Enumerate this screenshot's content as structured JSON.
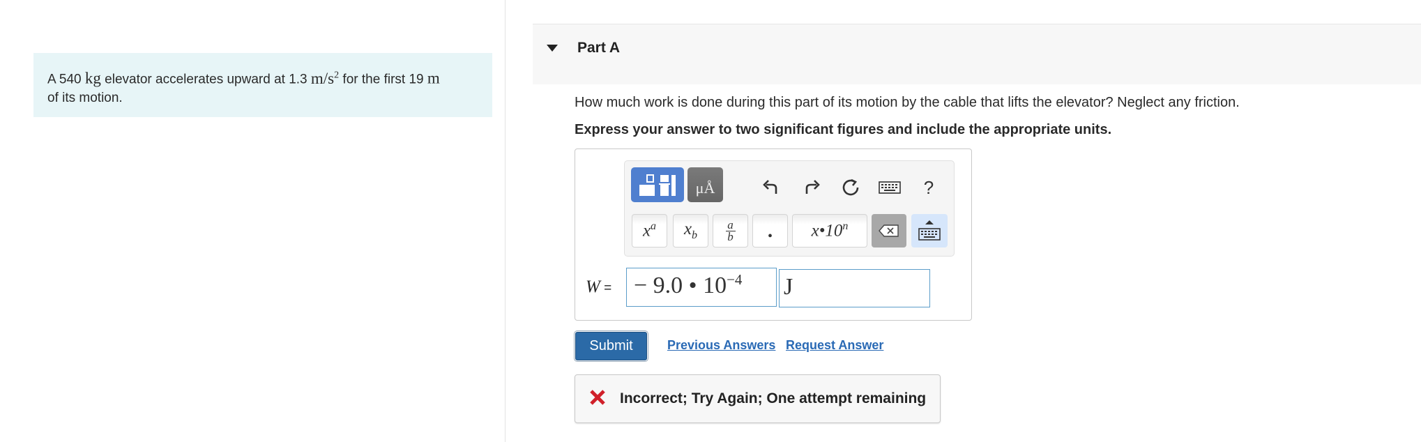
{
  "problem": {
    "text_before": "A 540 ",
    "mass_unit": "kg",
    "text_middle": " elevator accelerates upward at 1.3 ",
    "accel_unit": "m/s",
    "accel_exponent": "2",
    "text_after": " for the first 19 ",
    "distance_unit": "m",
    "text_end": "of its motion."
  },
  "part": {
    "title": "Part A",
    "question": "How much work is done during this part of its motion by the cable that lifts the elevator? Neglect any friction.",
    "instruction": "Express your answer to two significant figures and include the appropriate units."
  },
  "toolbar": {
    "units_label": "μÅ",
    "help_label": "?",
    "keys": {
      "superscript": "a",
      "subscript": "b",
      "fraction_num": "a",
      "fraction_den": "b",
      "decimal": "•",
      "sci_notation": "x•10",
      "sci_exponent": "n"
    }
  },
  "answer": {
    "variable": "W",
    "equals": " =",
    "value": "− 9.0 • 10",
    "exponent": "−4",
    "units": "J"
  },
  "actions": {
    "submit": "Submit",
    "previous_answers": "Previous Answers",
    "request_answer": "Request Answer"
  },
  "feedback": {
    "message": "Incorrect; Try Again; One attempt remaining",
    "color": "#d0202a"
  }
}
